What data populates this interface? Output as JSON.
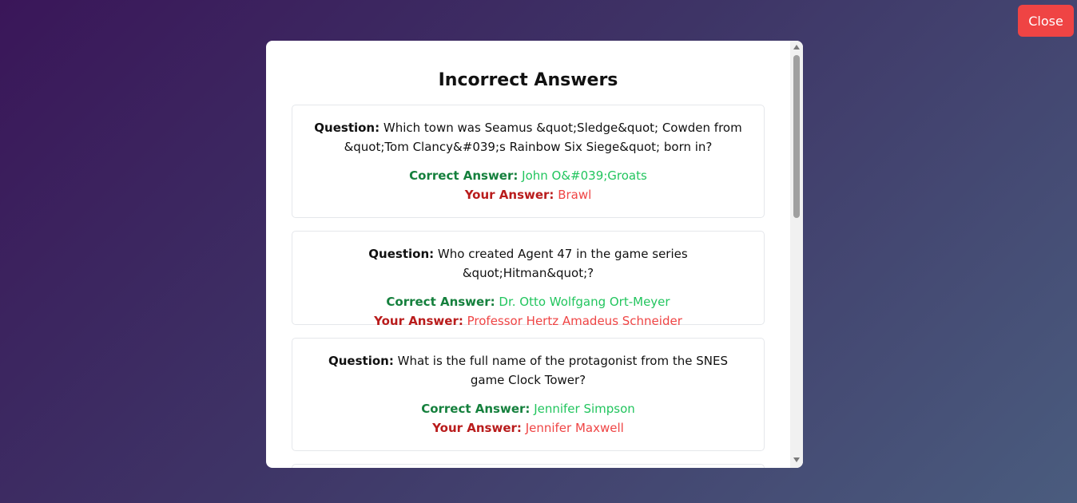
{
  "close_button": {
    "label": "Close"
  },
  "modal": {
    "title": "Incorrect Answers",
    "labels": {
      "question": "Question:",
      "correct": "Correct Answer:",
      "yours": "Your Answer:"
    },
    "items": [
      {
        "question": "Which town was Seamus &quot;Sledge&quot; Cowden from &quot;Tom Clancy&#039;s Rainbow Six Siege&quot; born in?",
        "correct": "John O&#039;Groats",
        "yours": "Brawl"
      },
      {
        "question": "Who created Agent 47 in the game series &quot;Hitman&quot;?",
        "correct": "Dr. Otto Wolfgang Ort-Meyer",
        "yours": "Professor Hertz Amadeus Schneider"
      },
      {
        "question": "What is the full name of the protagonist from the SNES game Clock Tower?",
        "correct": "Jennifer Simpson",
        "yours": "Jennifer Maxwell"
      }
    ]
  },
  "colors": {
    "close_bg": "#ef4444",
    "correct_label": "#15803d",
    "correct_value": "#22c55e",
    "wrong_label": "#b91c1c",
    "wrong_value": "#ef4444"
  }
}
